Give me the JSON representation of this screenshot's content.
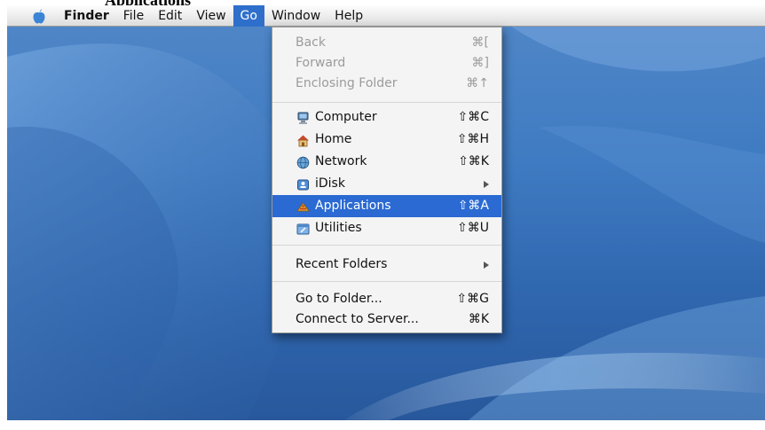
{
  "caption": "Applications",
  "menubar": {
    "app_name": "Finder",
    "items": [
      "File",
      "Edit",
      "View",
      "Go",
      "Window",
      "Help"
    ],
    "active_item": "Go"
  },
  "go_menu": {
    "back": {
      "label": "Back",
      "shortcut": "⌘["
    },
    "forward": {
      "label": "Forward",
      "shortcut": "⌘]"
    },
    "enclosing_folder": {
      "label": "Enclosing Folder",
      "shortcut": "⌘↑"
    },
    "computer": {
      "label": "Computer",
      "shortcut": "⇧⌘C",
      "icon": "computer-icon"
    },
    "home": {
      "label": "Home",
      "shortcut": "⇧⌘H",
      "icon": "home-icon"
    },
    "network": {
      "label": "Network",
      "shortcut": "⇧⌘K",
      "icon": "network-icon"
    },
    "idisk": {
      "label": "iDisk",
      "icon": "idisk-icon"
    },
    "applications": {
      "label": "Applications",
      "shortcut": "⇧⌘A",
      "icon": "applications-icon"
    },
    "utilities": {
      "label": "Utilities",
      "shortcut": "⇧⌘U",
      "icon": "utilities-icon"
    },
    "recent_folders": {
      "label": "Recent Folders"
    },
    "go_to_folder": {
      "label": "Go to Folder...",
      "shortcut": "⇧⌘G"
    },
    "connect_to_server": {
      "label": "Connect to Server...",
      "shortcut": "⌘K"
    }
  },
  "colors": {
    "highlight": "#2a6ad2",
    "desktop": "#3f7bc2",
    "disabled_text": "#9b9b9b"
  }
}
